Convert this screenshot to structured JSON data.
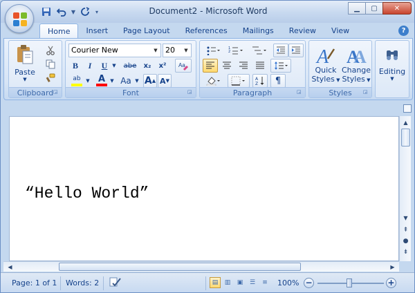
{
  "window": {
    "title": "Document2 - Microsoft Word",
    "minimize_glyph": "▁",
    "maximize_glyph": "▢",
    "close_glyph": "✕"
  },
  "quick_access": {
    "save_icon": "save-icon",
    "undo_icon": "undo-icon",
    "redo_icon": "redo-icon"
  },
  "ribbon_tabs": [
    {
      "label": "Home",
      "active": true
    },
    {
      "label": "Insert"
    },
    {
      "label": "Page Layout"
    },
    {
      "label": "References"
    },
    {
      "label": "Mailings"
    },
    {
      "label": "Review"
    },
    {
      "label": "View"
    }
  ],
  "groups": {
    "clipboard": {
      "label": "Clipboard",
      "paste_label": "Paste"
    },
    "font": {
      "label": "Font",
      "font_name": "Courier New",
      "font_size": "20",
      "bold": "B",
      "italic": "I",
      "underline": "U",
      "strike": "abe",
      "subscript": "x₂",
      "superscript": "x²",
      "highlight_letters": "ab",
      "font_color_letter": "A",
      "change_case": "Aa",
      "grow": "A",
      "shrink": "A"
    },
    "paragraph": {
      "label": "Paragraph",
      "show_marks": "¶"
    },
    "styles": {
      "label": "Styles",
      "quick_styles": "Quick Styles",
      "change_styles": "Change Styles",
      "quick_line1": "Quick",
      "quick_line2": "Styles",
      "change_line1": "Change",
      "change_line2": "Styles"
    },
    "editing": {
      "label": "Editing"
    }
  },
  "document": {
    "text": "“Hello World”"
  },
  "status": {
    "page": "Page: 1 of 1",
    "words": "Words: 2",
    "zoom": "100%",
    "zoom_level": 1.0
  },
  "colors": {
    "highlight": "#ffff00",
    "font_color": "#ff0000"
  }
}
